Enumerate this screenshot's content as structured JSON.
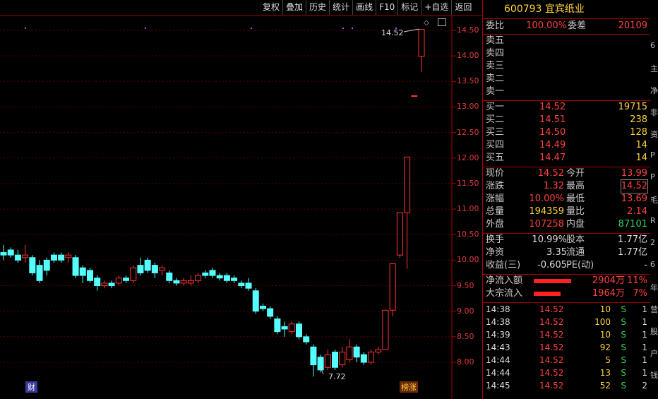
{
  "toolbar": [
    "复权",
    "叠加",
    "历史",
    "统计",
    "画线",
    "F10",
    "标记",
    "+自选",
    "返回"
  ],
  "stock": {
    "code": "600793",
    "name": "宜宾纸业"
  },
  "y_axis": [
    "14.50",
    "14.00",
    "13.50",
    "13.00",
    "12.50",
    "12.00",
    "11.50",
    "11.00",
    "10.50",
    "10.00",
    "9.50",
    "9.00",
    "8.50",
    "8.00"
  ],
  "annotations": {
    "high_label": "14.52",
    "low_label": "7.72",
    "cai": "财",
    "zhangting": "榜涨"
  },
  "chart_data": {
    "type": "candlestick",
    "ylim": [
      7.6,
      14.9
    ],
    "candles": [
      {
        "o": 10.15,
        "c": 10.1,
        "h": 10.3,
        "l": 10.0
      },
      {
        "o": 10.2,
        "c": 10.1,
        "h": 10.25,
        "l": 10.05
      },
      {
        "o": 10.1,
        "c": 10.0,
        "h": 10.2,
        "l": 9.95
      },
      {
        "o": 10.05,
        "c": 10.1,
        "h": 10.3,
        "l": 9.95
      },
      {
        "o": 10.05,
        "c": 9.75,
        "h": 10.1,
        "l": 9.7
      },
      {
        "o": 9.9,
        "c": 9.6,
        "h": 10.0,
        "l": 9.55
      },
      {
        "o": 10.0,
        "c": 9.8,
        "h": 10.05,
        "l": 9.7
      },
      {
        "o": 10.1,
        "c": 10.0,
        "h": 10.15,
        "l": 9.95
      },
      {
        "o": 10.1,
        "c": 10.0,
        "h": 10.15,
        "l": 9.95
      },
      {
        "o": 10.05,
        "c": 10.1,
        "h": 10.15,
        "l": 9.95
      },
      {
        "o": 10.05,
        "c": 9.7,
        "h": 10.1,
        "l": 9.65
      },
      {
        "o": 9.85,
        "c": 9.7,
        "h": 9.9,
        "l": 9.55
      },
      {
        "o": 9.8,
        "c": 9.6,
        "h": 9.85,
        "l": 9.55
      },
      {
        "o": 9.65,
        "c": 9.5,
        "h": 9.7,
        "l": 9.4
      },
      {
        "o": 9.5,
        "c": 9.55,
        "h": 9.6,
        "l": 9.45
      },
      {
        "o": 9.55,
        "c": 9.5,
        "h": 9.6,
        "l": 9.45
      },
      {
        "o": 9.55,
        "c": 9.65,
        "h": 9.7,
        "l": 9.5
      },
      {
        "o": 9.65,
        "c": 9.6,
        "h": 9.7,
        "l": 9.55
      },
      {
        "o": 9.6,
        "c": 9.85,
        "h": 9.9,
        "l": 9.55
      },
      {
        "o": 9.9,
        "c": 9.75,
        "h": 10.05,
        "l": 9.7
      },
      {
        "o": 10.0,
        "c": 9.8,
        "h": 10.05,
        "l": 9.75
      },
      {
        "o": 9.9,
        "c": 9.75,
        "h": 9.95,
        "l": 9.65
      },
      {
        "o": 9.8,
        "c": 9.85,
        "h": 9.9,
        "l": 9.7
      },
      {
        "o": 9.75,
        "c": 9.6,
        "h": 9.8,
        "l": 9.55
      },
      {
        "o": 9.6,
        "c": 9.55,
        "h": 9.65,
        "l": 9.5
      },
      {
        "o": 9.55,
        "c": 9.6,
        "h": 9.65,
        "l": 9.5
      },
      {
        "o": 9.55,
        "c": 9.6,
        "h": 9.7,
        "l": 9.5
      },
      {
        "o": 9.6,
        "c": 9.7,
        "h": 9.75,
        "l": 9.55
      },
      {
        "o": 9.75,
        "c": 9.7,
        "h": 9.8,
        "l": 9.65
      },
      {
        "o": 9.8,
        "c": 9.7,
        "h": 9.85,
        "l": 9.65
      },
      {
        "o": 9.7,
        "c": 9.65,
        "h": 9.75,
        "l": 9.6
      },
      {
        "o": 9.7,
        "c": 9.6,
        "h": 9.75,
        "l": 9.55
      },
      {
        "o": 9.65,
        "c": 9.6,
        "h": 9.7,
        "l": 9.55
      },
      {
        "o": 9.55,
        "c": 9.5,
        "h": 9.6,
        "l": 9.45
      },
      {
        "o": 9.55,
        "c": 9.45,
        "h": 9.65,
        "l": 9.4
      },
      {
        "o": 9.4,
        "c": 9.0,
        "h": 9.45,
        "l": 8.95
      },
      {
        "o": 9.1,
        "c": 9.05,
        "h": 9.15,
        "l": 9.0
      },
      {
        "o": 9.05,
        "c": 8.9,
        "h": 9.1,
        "l": 8.85
      },
      {
        "o": 8.85,
        "c": 8.6,
        "h": 8.9,
        "l": 8.55
      },
      {
        "o": 8.7,
        "c": 8.65,
        "h": 8.8,
        "l": 8.5
      },
      {
        "o": 8.6,
        "c": 8.75,
        "h": 8.8,
        "l": 8.55
      },
      {
        "o": 8.75,
        "c": 8.5,
        "h": 8.8,
        "l": 8.45
      },
      {
        "o": 8.5,
        "c": 8.4,
        "h": 8.55,
        "l": 8.35
      },
      {
        "o": 8.3,
        "c": 7.95,
        "h": 8.35,
        "l": 7.72
      },
      {
        "o": 8.1,
        "c": 7.85,
        "h": 8.15,
        "l": 7.8
      },
      {
        "o": 7.9,
        "c": 8.15,
        "h": 8.25,
        "l": 7.85
      },
      {
        "o": 8.2,
        "c": 7.9,
        "h": 8.25,
        "l": 7.85
      },
      {
        "o": 7.95,
        "c": 8.2,
        "h": 8.3,
        "l": 7.9
      },
      {
        "o": 8.05,
        "c": 8.3,
        "h": 8.45,
        "l": 8.0
      },
      {
        "o": 8.3,
        "c": 8.1,
        "h": 8.35,
        "l": 8.0
      },
      {
        "o": 8.15,
        "c": 8.0,
        "h": 8.2,
        "l": 7.95
      },
      {
        "o": 8.0,
        "c": 8.2,
        "h": 8.25,
        "l": 7.95
      },
      {
        "o": 8.2,
        "c": 8.25,
        "h": 8.3,
        "l": 8.15
      },
      {
        "o": 8.25,
        "c": 9.02,
        "h": 9.02,
        "l": 8.25
      },
      {
        "o": 9.02,
        "c": 9.93,
        "h": 9.93,
        "l": 8.9
      },
      {
        "o": 10.1,
        "c": 10.93,
        "h": 10.93,
        "l": 10.05
      },
      {
        "o": 10.93,
        "c": 12.02,
        "h": 12.02,
        "l": 9.83
      },
      {
        "o": 13.22,
        "c": 13.22,
        "h": 13.22,
        "l": 13.22
      },
      {
        "o": 13.99,
        "c": 14.52,
        "h": 14.52,
        "l": 13.69
      }
    ]
  },
  "quote": {
    "weibi_label": "委比",
    "weibi": "100.00%",
    "weicha_label": "委差",
    "weicha": "20109",
    "sell": [
      {
        "l": "卖五"
      },
      {
        "l": "卖四"
      },
      {
        "l": "卖三"
      },
      {
        "l": "卖二"
      },
      {
        "l": "卖一"
      }
    ],
    "buy": [
      {
        "l": "买一",
        "p": "14.52",
        "v": "19715"
      },
      {
        "l": "买二",
        "p": "14.51",
        "v": "238"
      },
      {
        "l": "买三",
        "p": "14.50",
        "v": "128"
      },
      {
        "l": "买四",
        "p": "14.49",
        "v": "14"
      },
      {
        "l": "买五",
        "p": "14.47",
        "v": "14"
      }
    ],
    "stats": [
      {
        "l1": "现价",
        "v1": "14.52",
        "l2": "今开",
        "v2": "13.99"
      },
      {
        "l1": "涨跌",
        "v1": "1.32",
        "l2": "最高",
        "v2": "14.52"
      },
      {
        "l1": "涨幅",
        "v1": "10.00%",
        "l2": "最低",
        "v2": "13.69"
      },
      {
        "l1": "总量",
        "v1": "194359",
        "l2": "量比",
        "v2": "2.14"
      },
      {
        "l1": "外盘",
        "v1": "107258",
        "l2": "内盘",
        "v2": "87101"
      }
    ],
    "stats2": [
      {
        "l1": "换手",
        "v1": "10.99%",
        "l2": "股本",
        "v2": "1.77亿"
      },
      {
        "l1": "净资",
        "v1": "3.35",
        "l2": "流通",
        "v2": "1.77亿"
      },
      {
        "l1": "收益(三)",
        "v1": "-0.605",
        "l2": "PE(动)",
        "v2": "-"
      }
    ],
    "flows": [
      {
        "l": "净流入额",
        "v": "2904万",
        "p": "11%",
        "bar": 0.38
      },
      {
        "l": "大宗流入",
        "v": "1964万",
        "p": "7%",
        "bar": 0.27
      }
    ],
    "ticks": [
      {
        "t": "14:38",
        "p": "14.52",
        "v": "10",
        "s": "S",
        "n": "1"
      },
      {
        "t": "14:38",
        "p": "14.52",
        "v": "100",
        "s": "S",
        "n": "1"
      },
      {
        "t": "14:39",
        "p": "14.52",
        "v": "10",
        "s": "S",
        "n": "1"
      },
      {
        "t": "14:43",
        "p": "14.52",
        "v": "92",
        "s": "S",
        "n": "1"
      },
      {
        "t": "14:44",
        "p": "14.52",
        "v": "5",
        "s": "S",
        "n": "1"
      },
      {
        "t": "14:44",
        "p": "14.52",
        "v": "13",
        "s": "S",
        "n": "1"
      },
      {
        "t": "14:45",
        "p": "14.52",
        "v": "52",
        "s": "S",
        "n": "2"
      }
    ]
  },
  "edge_chars": [
    "6",
    "主",
    "净",
    "非",
    "资",
    "P",
    "P",
    "毛",
    "R",
    "2",
    "6",
    "年",
    "营",
    "股",
    "户",
    "钱"
  ]
}
